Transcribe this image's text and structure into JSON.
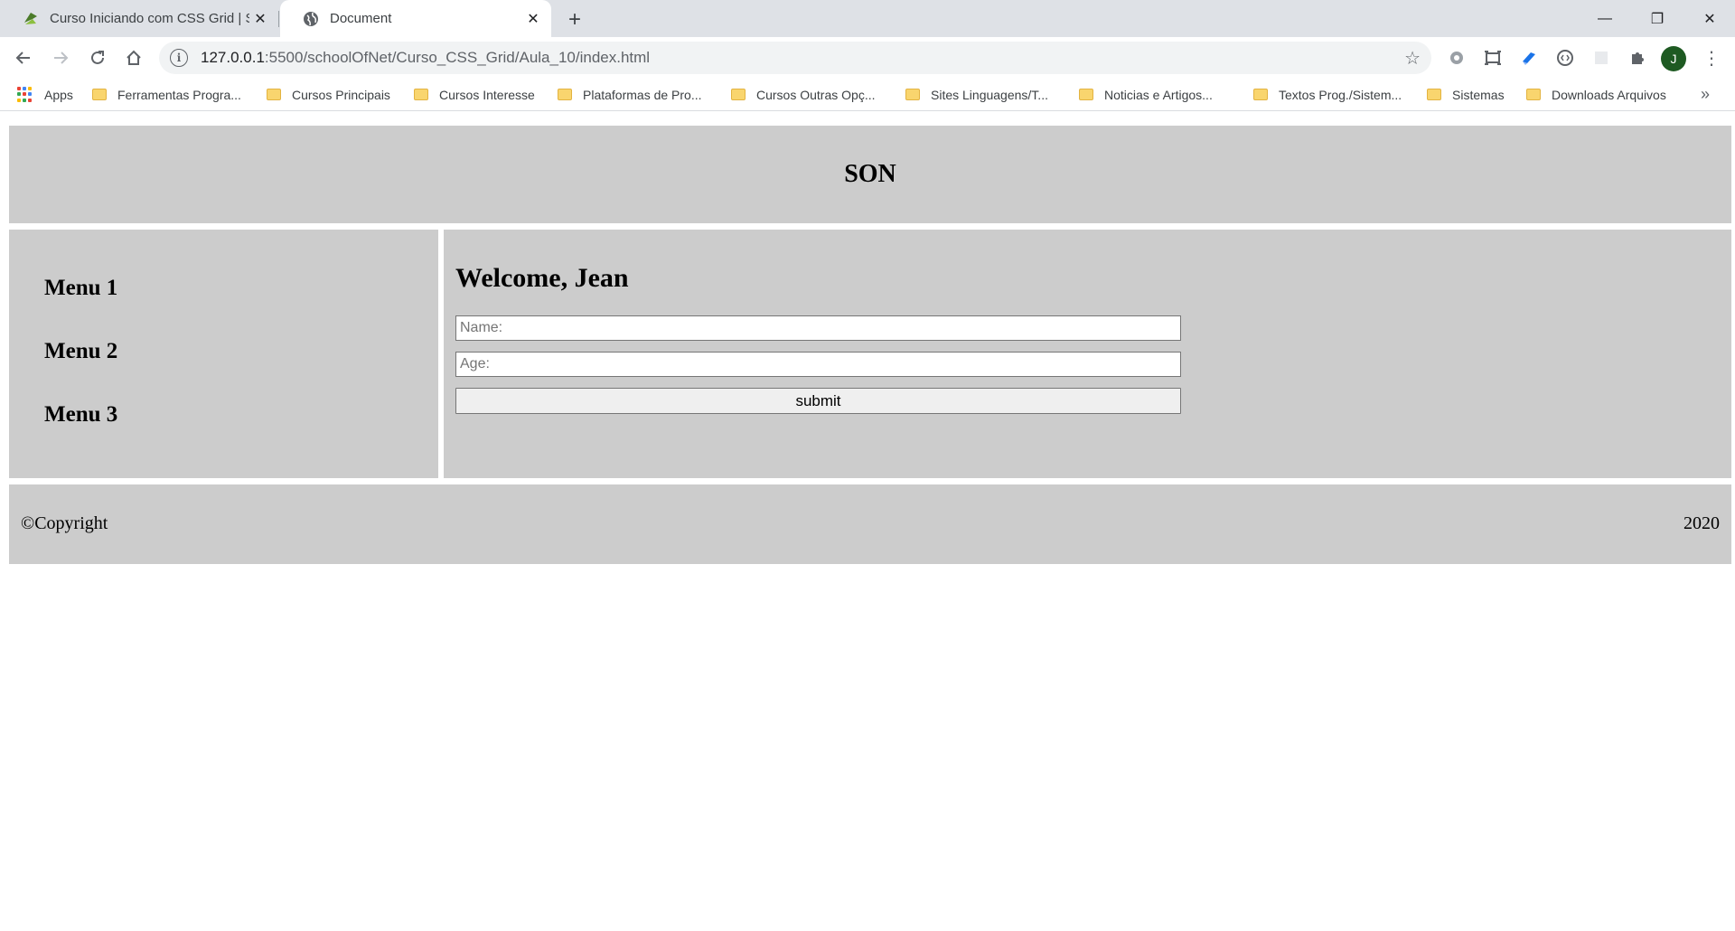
{
  "browser": {
    "tabs": [
      {
        "title": "Curso Iniciando com CSS Grid | School of Net",
        "active": false
      },
      {
        "title": "Document",
        "active": true
      }
    ],
    "new_tab_symbol": "+",
    "window_controls": {
      "minimize": "—",
      "restore": "❐",
      "close": "✕"
    },
    "address": {
      "host": "127.0.0.1",
      "rest": ":5500/schoolOfNet/Curso_CSS_Grid/Aula_10/index.html"
    },
    "bookmarks": [
      "Apps",
      "Ferramentas Progra...",
      "Cursos Principais",
      "Cursos Interesse",
      "Plataformas de Pro...",
      "Cursos Outras Opç...",
      "Sites Linguagens/T...",
      "Noticias e Artigos...",
      "Textos Prog./Sistem...",
      "Sistemas",
      "Downloads Arquivos"
    ],
    "bookmarks_more": "»",
    "profile_initial": "J",
    "colors": {
      "tabstrip": "#dee1e6",
      "omnibox": "#f1f3f4",
      "profile": "#1e5a22"
    }
  },
  "page": {
    "header_title": "SON",
    "menu": [
      "Menu 1",
      "Menu 2",
      "Menu 3"
    ],
    "welcome": "Welcome, Jean",
    "name_placeholder": "Name:",
    "age_placeholder": "Age:",
    "submit_label": "submit",
    "footer_left": "©Copyright",
    "footer_right": "2020",
    "colors": {
      "block": "#cccccc"
    }
  }
}
